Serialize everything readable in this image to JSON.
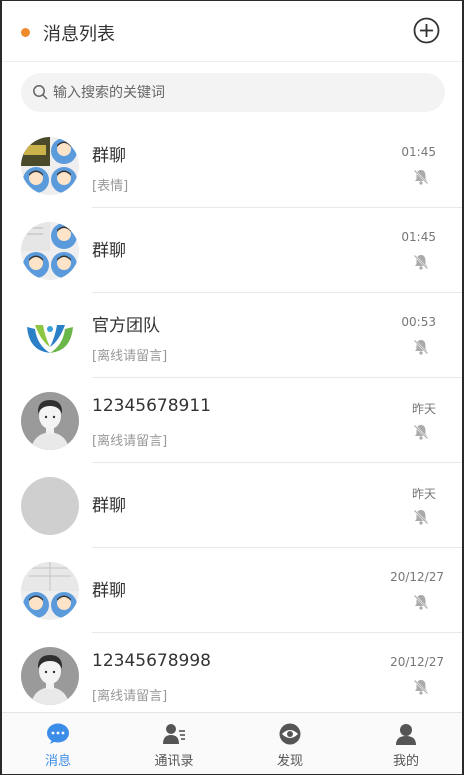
{
  "header": {
    "title": "消息列表"
  },
  "search": {
    "placeholder": "输入搜索的关键词"
  },
  "conversations": [
    {
      "name": "群聊",
      "preview": "[表情]",
      "time": "01:45",
      "avatar": "group-avatar"
    },
    {
      "name": "群聊",
      "preview": "",
      "time": "01:45",
      "avatar": "group-avatar"
    },
    {
      "name": "官方团队",
      "preview": "[离线请留言]",
      "time": "00:53",
      "avatar": "team-logo"
    },
    {
      "name": "12345678911",
      "preview": "[离线请留言]",
      "time": "昨天",
      "avatar": "user-avatar"
    },
    {
      "name": "群聊",
      "preview": "",
      "time": "昨天",
      "avatar": "blank-avatar"
    },
    {
      "name": "群聊",
      "preview": "",
      "time": "20/12/27",
      "avatar": "group-avatar"
    },
    {
      "name": "12345678998",
      "preview": "[离线请留言]",
      "time": "20/12/27",
      "avatar": "user-avatar"
    }
  ],
  "tabs": [
    {
      "label": "消息",
      "icon": "chat-bubble-icon",
      "active": true
    },
    {
      "label": "通讯录",
      "icon": "contacts-icon",
      "active": false
    },
    {
      "label": "发现",
      "icon": "eye-icon",
      "active": false
    },
    {
      "label": "我的",
      "icon": "person-icon",
      "active": false
    }
  ],
  "colors": {
    "accent": "#3c8de8",
    "dot": "#f08a2e"
  }
}
